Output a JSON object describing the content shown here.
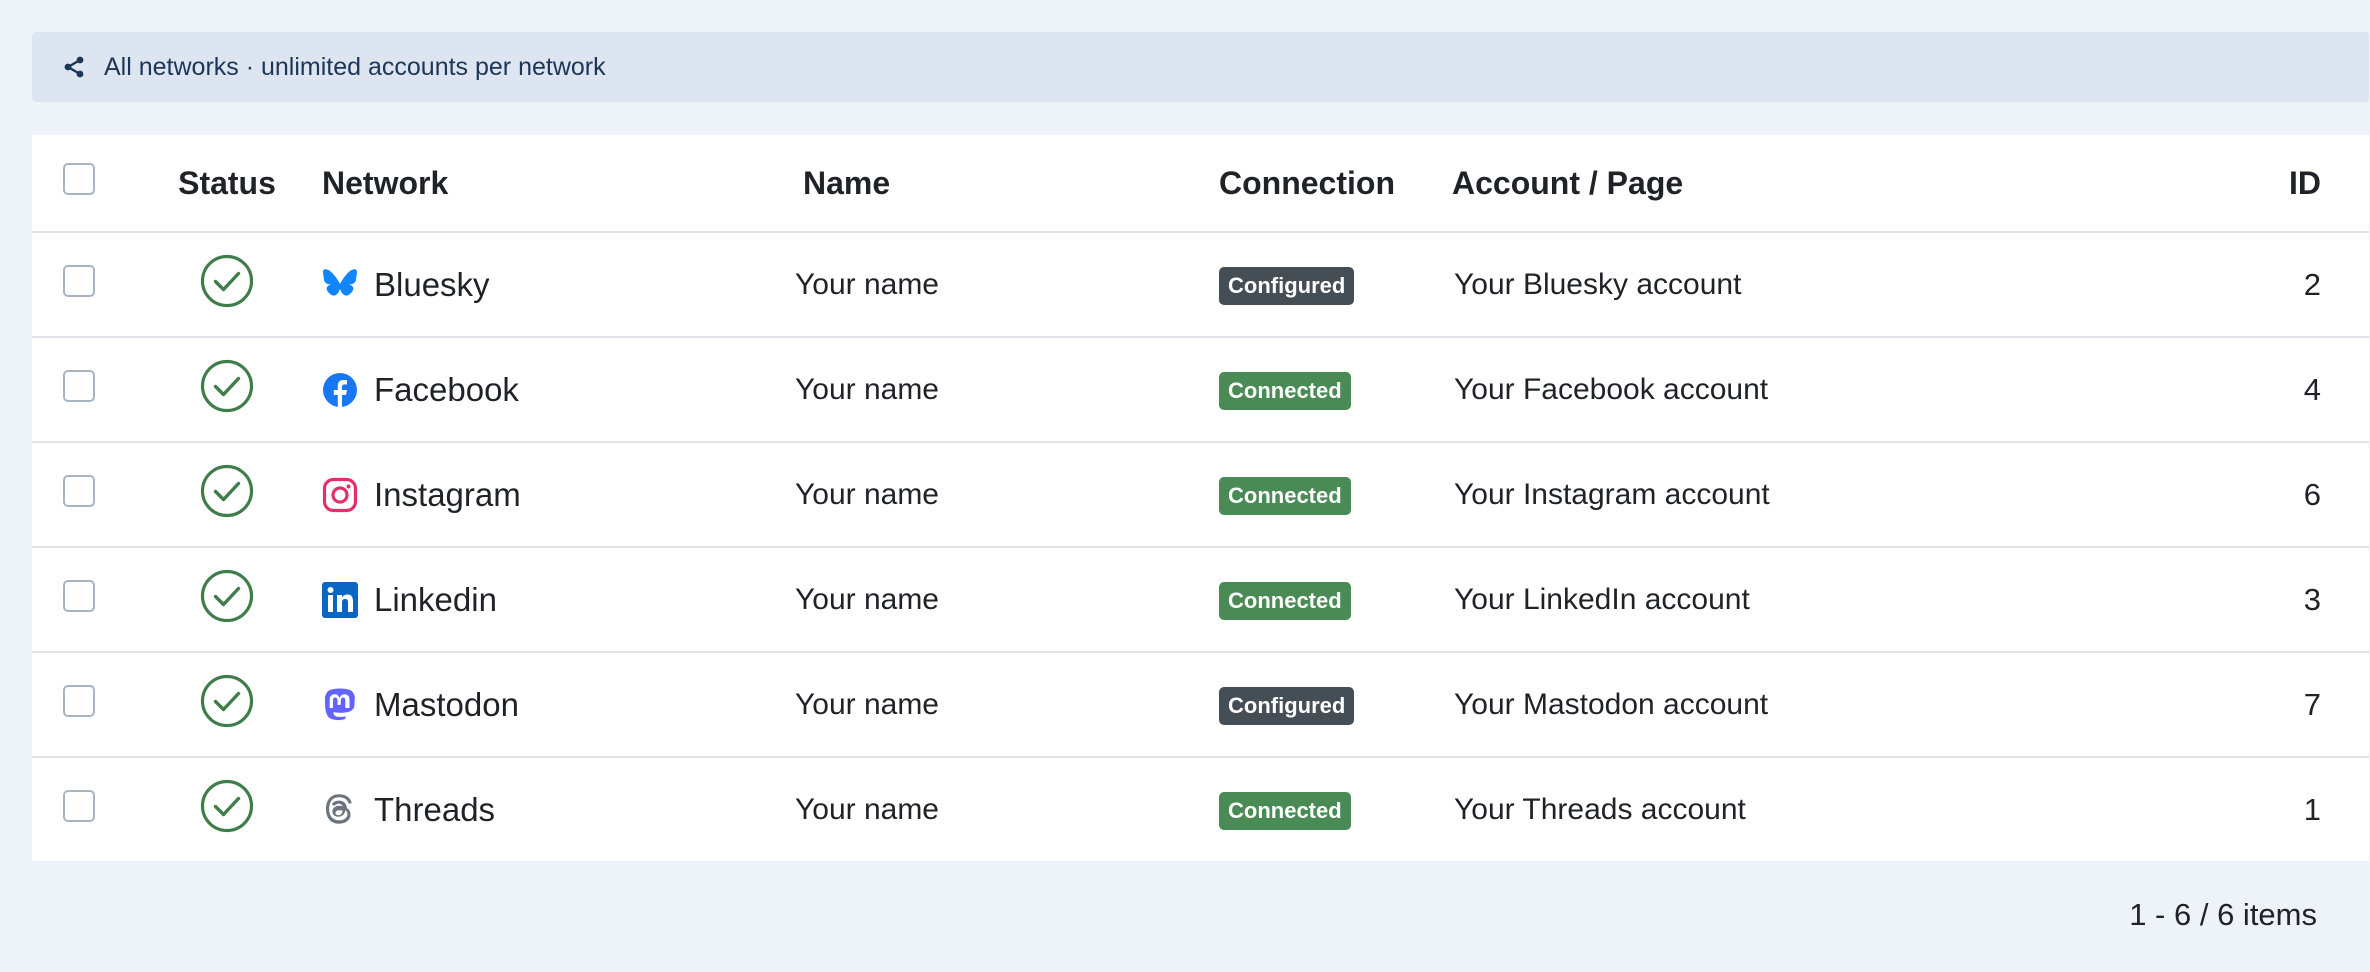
{
  "info_bar": {
    "icon": "share-nodes-icon",
    "text": "All networks · unlimited accounts per network"
  },
  "table": {
    "headers": {
      "status": "Status",
      "network": "Network",
      "name": "Name",
      "connection": "Connection",
      "account": "Account / Page",
      "id": "ID"
    },
    "rows": [
      {
        "network": "Bluesky",
        "icon": "bluesky-icon",
        "name": "Your name",
        "connection": "Configured",
        "account": "Your Bluesky account",
        "id": "2"
      },
      {
        "network": "Facebook",
        "icon": "facebook-icon",
        "name": "Your name",
        "connection": "Connected",
        "account": "Your Facebook account",
        "id": "4"
      },
      {
        "network": "Instagram",
        "icon": "instagram-icon",
        "name": "Your name",
        "connection": "Connected",
        "account": "Your Instagram account",
        "id": "6"
      },
      {
        "network": "Linkedin",
        "icon": "linkedin-icon",
        "name": "Your name",
        "connection": "Connected",
        "account": "Your LinkedIn account",
        "id": "3"
      },
      {
        "network": "Mastodon",
        "icon": "mastodon-icon",
        "name": "Your name",
        "connection": "Configured",
        "account": "Your Mastodon account",
        "id": "7"
      },
      {
        "network": "Threads",
        "icon": "threads-icon",
        "name": "Your name",
        "connection": "Connected",
        "account": "Your Threads account",
        "id": "1"
      }
    ]
  },
  "pager": {
    "text": "1 - 6 / 6 items"
  },
  "colors": {
    "configured": "#454d55",
    "connected": "#4a8a55",
    "status_check": "#3f7d4a",
    "bluesky": "#1185fe",
    "facebook": "#1877f2",
    "instagram": "#e1306c",
    "linkedin": "#0a66c2",
    "mastodon": "#6364ff",
    "threads": "#6c757d"
  }
}
